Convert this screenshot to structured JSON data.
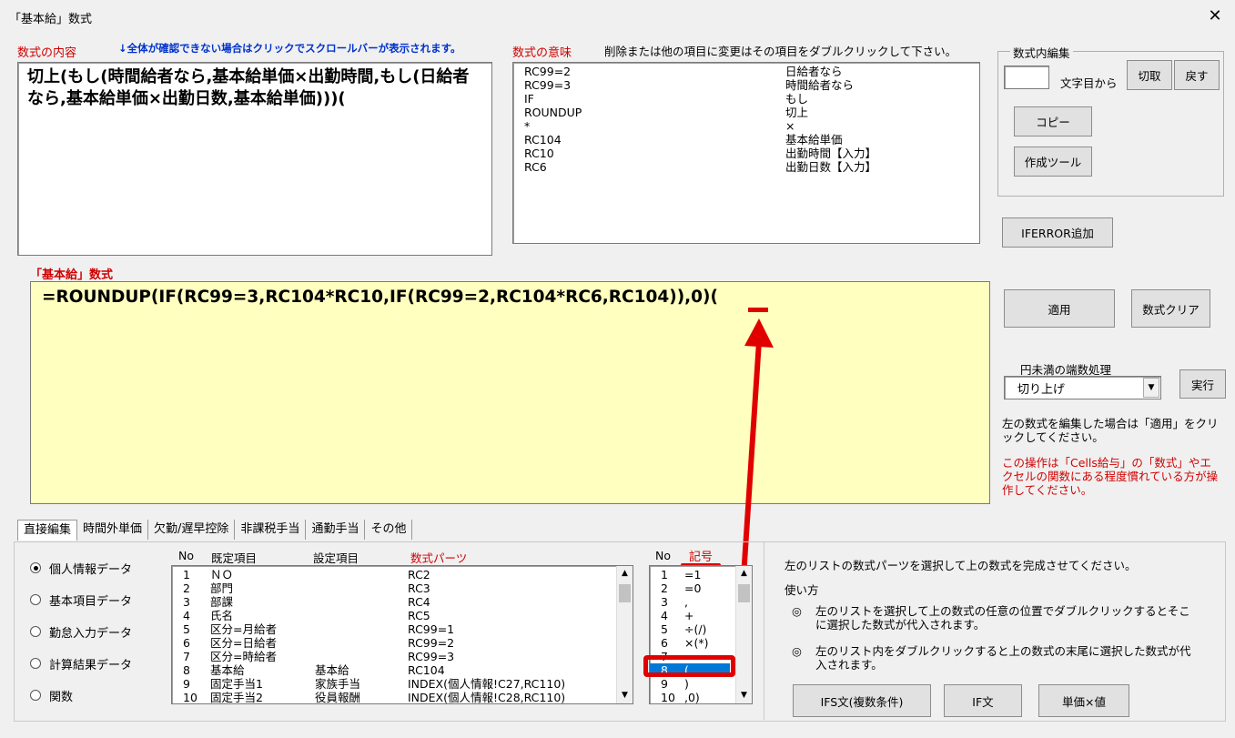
{
  "window": {
    "title": "「基本給」数式",
    "close": "✕"
  },
  "formula_content": {
    "label": "数式の内容",
    "hint": "↓全体が確認できない場合はクリックでスクロールバーが表示されます。",
    "text": "切上(もし(時間給者なら,基本給単価×出勤時間,もし(日給者なら,基本給単価×出勤日数,基本給単価)))("
  },
  "formula_meaning": {
    "label": "数式の意味",
    "hint": "削除または他の項目に変更はその項目をダブルクリックして下さい。",
    "rows": [
      {
        "code": "RC99=2",
        "meaning": "日給者なら"
      },
      {
        "code": "RC99=3",
        "meaning": "時間給者なら"
      },
      {
        "code": "IF",
        "meaning": "もし"
      },
      {
        "code": "ROUNDUP",
        "meaning": "切上"
      },
      {
        "code": "*",
        "meaning": "×"
      },
      {
        "code": "RC104",
        "meaning": "基本給単価"
      },
      {
        "code": "RC10",
        "meaning": "出勤時間【入力】"
      },
      {
        "code": "RC6",
        "meaning": "出勤日数【入力】"
      }
    ]
  },
  "edit_group": {
    "label": "数式内編集",
    "position_value": "",
    "position_suffix": "文字目から",
    "cut": "切取",
    "undo": "戻す",
    "copy": "コピー",
    "create_tool": "作成ツール"
  },
  "iferror_button": "IFERROR追加",
  "formula_editor": {
    "label": "「基本給」数式",
    "text": "=ROUNDUP(IF(RC99=3,RC104*RC10,IF(RC99=2,RC104*RC6,RC104)),0)("
  },
  "apply_button": "適用",
  "clear_button": "数式クリア",
  "rounding": {
    "label": "円未満の端数処理",
    "selected": "切り上げ",
    "execute": "実行"
  },
  "note_apply": "左の数式を編集した場合は「適用」をクリックしてください。",
  "warning": "この操作は「Cells給与」の「数式」やエクセルの関数にある程度慣れている方が操作してください。",
  "tabs": [
    "直接編集",
    "時間外単価",
    "欠勤/遅早控除",
    "非課税手当",
    "通勤手当",
    "その他"
  ],
  "radios": [
    {
      "label": "個人情報データ",
      "checked": true
    },
    {
      "label": "基本項目データ",
      "checked": false
    },
    {
      "label": "勤怠入力データ",
      "checked": false
    },
    {
      "label": "計算結果データ",
      "checked": false
    },
    {
      "label": "関数",
      "checked": false
    }
  ],
  "parts_list": {
    "headers": {
      "no": "No",
      "default": "既定項目",
      "setting": "設定項目",
      "parts": "数式パーツ"
    },
    "rows": [
      {
        "no": "1",
        "default": "ＮＯ",
        "setting": "",
        "parts": "RC2"
      },
      {
        "no": "2",
        "default": "部門",
        "setting": "",
        "parts": "RC3"
      },
      {
        "no": "3",
        "default": "部課",
        "setting": "",
        "parts": "RC4"
      },
      {
        "no": "4",
        "default": "氏名",
        "setting": "",
        "parts": "RC5"
      },
      {
        "no": "5",
        "default": "区分=月給者",
        "setting": "",
        "parts": "RC99=1"
      },
      {
        "no": "6",
        "default": "区分=日給者",
        "setting": "",
        "parts": "RC99=2"
      },
      {
        "no": "7",
        "default": "区分=時給者",
        "setting": "",
        "parts": "RC99=3"
      },
      {
        "no": "8",
        "default": "基本給",
        "setting": "基本給",
        "parts": "RC104"
      },
      {
        "no": "9",
        "default": "固定手当1",
        "setting": "家族手当",
        "parts": "INDEX(個人情報!C27,RC110)"
      },
      {
        "no": "10",
        "default": "固定手当2",
        "setting": "役員報酬",
        "parts": "INDEX(個人情報!C28,RC110)"
      }
    ]
  },
  "symbol_list": {
    "headers": {
      "no": "No",
      "symbol": "記号"
    },
    "rows": [
      {
        "no": "1",
        "symbol": "=1"
      },
      {
        "no": "2",
        "symbol": "=0"
      },
      {
        "no": "3",
        "symbol": ","
      },
      {
        "no": "4",
        "symbol": "+"
      },
      {
        "no": "5",
        "symbol": "÷(/)"
      },
      {
        "no": "6",
        "symbol": "×(*)"
      },
      {
        "no": "7",
        "symbol": ""
      },
      {
        "no": "8",
        "symbol": "("
      },
      {
        "no": "9",
        "symbol": ")"
      },
      {
        "no": "10",
        "symbol": ",0)"
      }
    ],
    "selected_index": 7
  },
  "help": {
    "intro": "左のリストの数式パーツを選択して上の数式を完成させてください。",
    "usage_title": "使い方",
    "bullet_mark": "◎",
    "bullet1": "左のリストを選択して上の数式の任意の位置でダブルクリックするとそこに選択した数式が代入されます。",
    "bullet2": "左のリスト内をダブルクリックすると上の数式の末尾に選択した数式が代入されます。"
  },
  "bottom_buttons": {
    "ifs": "IFS文(複数条件)",
    "if": "IF文",
    "unit_value": "単価×値"
  },
  "colors": {
    "editor_bg": "#ffffc0",
    "accent_red": "#e00000",
    "selection_blue": "#0078d7"
  }
}
